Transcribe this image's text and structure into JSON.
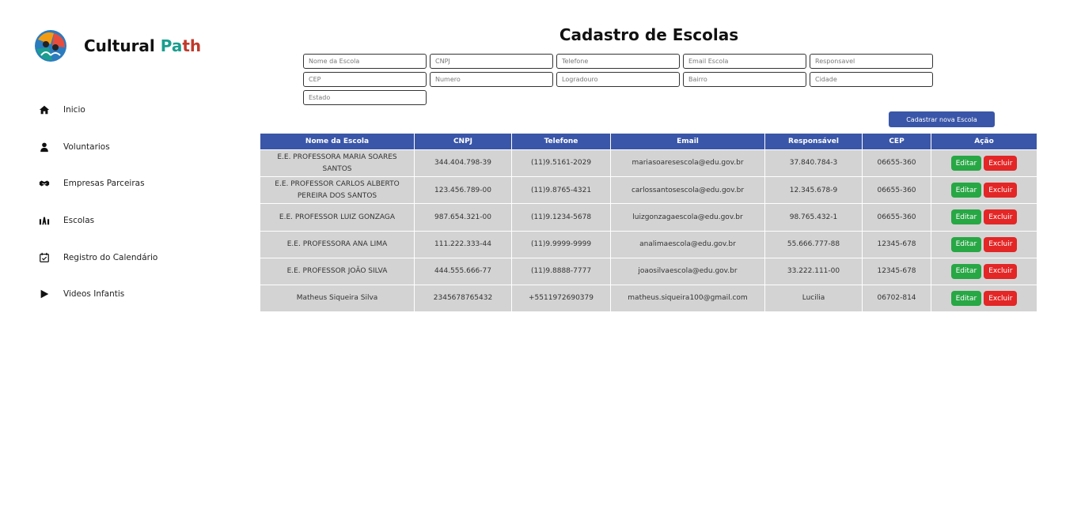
{
  "brand": {
    "name_part1": "Cultural ",
    "name_part2": "Pa",
    "name_part3": "th"
  },
  "sidebar": {
    "items": [
      {
        "label": "Inicio",
        "icon": "home-icon"
      },
      {
        "label": "Voluntarios",
        "icon": "user-icon"
      },
      {
        "label": "Empresas Parceiras",
        "icon": "handshake-icon"
      },
      {
        "label": "Escolas",
        "icon": "school-icon"
      },
      {
        "label": "Registro do Calendário",
        "icon": "calendar-icon"
      },
      {
        "label": "Videos Infantis",
        "icon": "play-icon"
      }
    ]
  },
  "page": {
    "title": "Cadastro de Escolas"
  },
  "form": {
    "nome_escola": "Nome da Escola",
    "cnpj": "CNPJ",
    "telefone": "Telefone",
    "email": "Email Escola",
    "responsavel": "Responsavel",
    "cep": "CEP",
    "numero": "Numero",
    "logradouro": "Logradouro",
    "bairro": "Bairro",
    "cidade": "Cidade",
    "estado": "Estado"
  },
  "actions": {
    "new_school": "Cadastrar nova Escola",
    "edit": "Editar",
    "delete": "Excluir"
  },
  "table": {
    "headers": [
      "Nome da Escola",
      "CNPJ",
      "Telefone",
      "Email",
      "Responsável",
      "CEP",
      "Ação"
    ],
    "rows": [
      [
        "E.E. PROFESSORA MARIA SOARES SANTOS",
        "344.404.798-39",
        "(11)9.5161-2029",
        "mariasoaresescola@edu.gov.br",
        "37.840.784-3",
        "06655-360"
      ],
      [
        "E.E. PROFESSOR CARLOS ALBERTO PEREIRA DOS SANTOS",
        "123.456.789-00",
        "(11)9.8765-4321",
        "carlossantosescola@edu.gov.br",
        "12.345.678-9",
        "06655-360"
      ],
      [
        "E.E. PROFESSOR LUIZ GONZAGA",
        "987.654.321-00",
        "(11)9.1234-5678",
        "luizgonzagaescola@edu.gov.br",
        "98.765.432-1",
        "06655-360"
      ],
      [
        "E.E. PROFESSORA ANA LIMA",
        "111.222.333-44",
        "(11)9.9999-9999",
        "analimaescola@edu.gov.br",
        "55.666.777-88",
        "12345-678"
      ],
      [
        "E.E. PROFESSOR JOÃO SILVA",
        "444.555.666-77",
        "(11)9.8888-7777",
        "joaosilvaescola@edu.gov.br",
        "33.222.111-00",
        "12345-678"
      ],
      [
        "Matheus Siqueira Silva",
        "2345678765432",
        "+5511972690379",
        "matheus.siqueira100@gmail.com",
        "Lucilia",
        "06702-814"
      ]
    ]
  },
  "colors": {
    "primary": "#3a56a8",
    "edit": "#28a745",
    "delete": "#e32626",
    "row_bg": "#d3d3d3"
  }
}
